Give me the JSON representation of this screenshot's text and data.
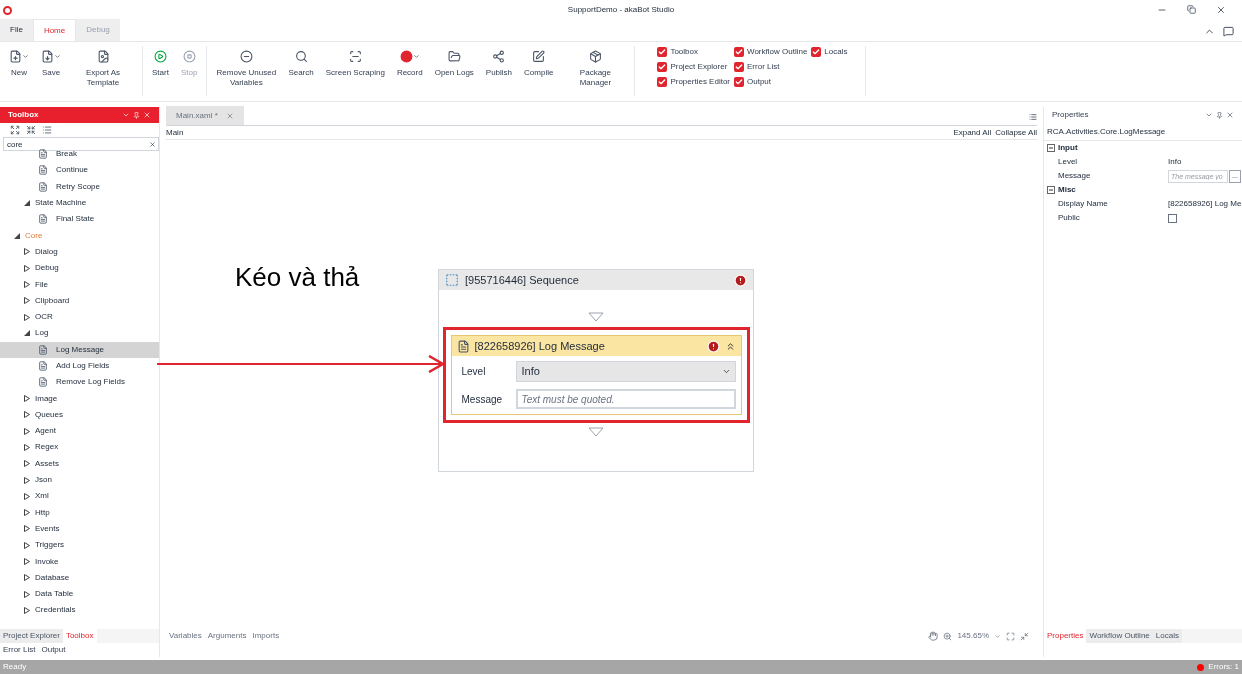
{
  "window": {
    "title": "SupportDemo - akaBot Studio"
  },
  "ribbon_tabs": [
    {
      "label": "File",
      "selected": false,
      "disabled": false
    },
    {
      "label": "Home",
      "selected": true,
      "disabled": false
    },
    {
      "label": "Debug",
      "selected": false,
      "disabled": true
    }
  ],
  "ribbon_groups": [
    {
      "buttons": [
        {
          "label": "New",
          "dropdown": true,
          "disabled": false
        },
        {
          "label": "Save",
          "dropdown": true,
          "disabled": false
        },
        {
          "label": "Export As Template",
          "dropdown": false,
          "disabled": false
        }
      ]
    },
    {
      "buttons": [
        {
          "label": "Start",
          "dropdown": false,
          "disabled": false
        },
        {
          "label": "Stop",
          "dropdown": false,
          "disabled": true
        }
      ]
    },
    {
      "buttons": [
        {
          "label": "Remove Unused Variables",
          "dropdown": false,
          "disabled": false
        },
        {
          "label": "Search",
          "dropdown": false,
          "disabled": false
        },
        {
          "label": "Screen Scraping",
          "dropdown": false,
          "disabled": false
        },
        {
          "label": "Record",
          "dropdown": true,
          "disabled": false
        },
        {
          "label": "Open Logs",
          "dropdown": false,
          "disabled": false
        },
        {
          "label": "Publish",
          "dropdown": false,
          "disabled": false
        },
        {
          "label": "Compile",
          "dropdown": false,
          "disabled": false
        },
        {
          "label": "Package Manager",
          "dropdown": false,
          "disabled": false
        }
      ]
    }
  ],
  "panel_toggles": [
    [
      {
        "label": "Toolbox",
        "checked": true
      },
      {
        "label": "Project Explorer",
        "checked": true
      },
      {
        "label": "Properties Editor",
        "checked": true
      }
    ],
    [
      {
        "label": "Workflow Outline",
        "checked": true
      },
      {
        "label": "Error List",
        "checked": true
      },
      {
        "label": "Output",
        "checked": true
      }
    ],
    [
      {
        "label": "Locals",
        "checked": true
      }
    ]
  ],
  "toolbox": {
    "title": "Toolbox",
    "search": {
      "value": "core"
    },
    "tree": [
      {
        "children": [
          {
            "children": [
              {
                "label": "Break",
                "selected": false
              },
              {
                "label": "Continue",
                "selected": false
              },
              {
                "label": "Retry Scope",
                "selected": false
              }
            ]
          },
          {
            "label": "State Machine",
            "expanded": true,
            "children": [
              {
                "label": "Final State",
                "selected": false
              }
            ]
          }
        ]
      },
      {
        "label": "Core",
        "expanded": true,
        "children": [
          {
            "label": "Dialog",
            "expanded": false
          },
          {
            "label": "Debug",
            "expanded": false
          },
          {
            "label": "File",
            "expanded": false
          },
          {
            "label": "Clipboard",
            "expanded": false
          },
          {
            "label": "OCR",
            "expanded": false
          },
          {
            "label": "Log",
            "expanded": true,
            "children": [
              {
                "label": "Log Message",
                "selected": true
              },
              {
                "label": "Add Log Fields",
                "selected": false
              },
              {
                "label": "Remove Log Fields",
                "selected": false
              }
            ]
          },
          {
            "label": "Image",
            "expanded": false
          },
          {
            "label": "Queues",
            "expanded": false
          },
          {
            "label": "Agent",
            "expanded": false
          },
          {
            "label": "Regex",
            "expanded": false
          },
          {
            "label": "Assets",
            "expanded": false
          },
          {
            "label": "Json",
            "expanded": false
          },
          {
            "label": "Xml",
            "expanded": false
          },
          {
            "label": "Http",
            "expanded": false
          },
          {
            "label": "Events",
            "expanded": false
          },
          {
            "label": "Triggers",
            "expanded": false
          },
          {
            "label": "Invoke",
            "expanded": false
          },
          {
            "label": "Database",
            "expanded": false
          },
          {
            "label": "Data Table",
            "expanded": false
          },
          {
            "label": "Credentials",
            "expanded": false
          }
        ]
      }
    ]
  },
  "left_tabs": [
    {
      "label": "Project Explorer",
      "selected": false
    },
    {
      "label": "Toolbox",
      "selected": true
    }
  ],
  "left_tabs_2": [
    {
      "label": "Error List",
      "selected": false
    },
    {
      "label": "Output",
      "selected": false
    }
  ],
  "document_tabs": [
    {
      "label": "Main.xaml *",
      "selected": true
    }
  ],
  "breadcrumb": "Main",
  "canvas_links": [
    "Expand All",
    "Collapse All"
  ],
  "annotation": "Kéo và thả",
  "sequence": {
    "title": "[955716446] Sequence",
    "error": true,
    "activity": {
      "title": "[822658926] Log Message",
      "error": true,
      "highlighted": true,
      "fields": [
        {
          "kind": "dropdown",
          "label": "Level",
          "value": "Info"
        },
        {
          "kind": "text",
          "label": "Message",
          "placeholder": "Text must be quoted."
        }
      ]
    }
  },
  "designer_tabs": [
    "Variables",
    "Arguments",
    "Imports"
  ],
  "zoom": "145.65%",
  "properties": {
    "title": "Properties",
    "type_name": "RCA.Activities.Core.LogMessage",
    "categories": [
      {
        "label": "Input",
        "expanded": true,
        "rows": [
          {
            "kind": "text",
            "name": "Level",
            "value": "Info"
          },
          {
            "kind": "input",
            "name": "Message",
            "placeholder": "The message yo",
            "button": "..."
          }
        ]
      },
      {
        "label": "Misc",
        "expanded": true,
        "rows": [
          {
            "kind": "text",
            "name": "Display Name",
            "value": "[822658926] Log Me"
          },
          {
            "kind": "checkbox",
            "name": "Public",
            "checked": false
          }
        ]
      }
    ]
  },
  "right_tabs": [
    {
      "label": "Properties",
      "selected": true
    },
    {
      "label": "Workflow Outline",
      "selected": false
    },
    {
      "label": "Locals",
      "selected": false
    }
  ],
  "status_bar": {
    "left": "Ready",
    "errors": "Errors: 1"
  }
}
